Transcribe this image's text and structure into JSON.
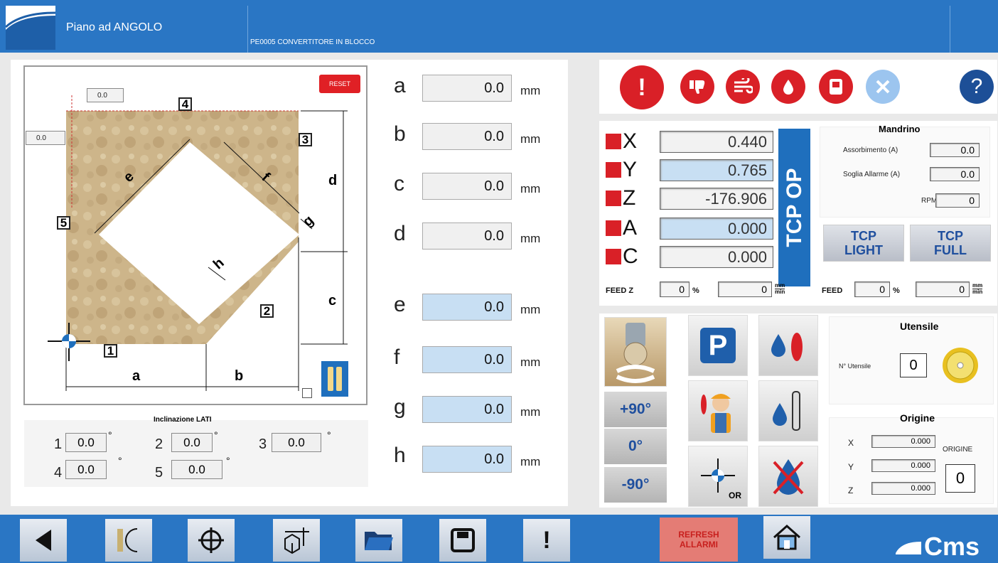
{
  "header": {
    "app_title": "Piano ad ANGOLO",
    "program_name": "PE0005 CONVERTITORE IN BLOCCO"
  },
  "drawing": {
    "reset_label": "RESET",
    "offset_top": "0.0",
    "offset_left": "0.0",
    "labels": {
      "a": "a",
      "b": "b",
      "c": "c",
      "d": "d",
      "e": "e",
      "f": "f",
      "g": "g",
      "h": "h",
      "n1": "1",
      "n2": "2",
      "n3": "3",
      "n4": "4",
      "n5": "5"
    }
  },
  "inclinazione": {
    "title": "Inclinazione LATI",
    "degree_symbol": "°",
    "items": [
      {
        "label": "1",
        "value": "0.0"
      },
      {
        "label": "2",
        "value": "0.0"
      },
      {
        "label": "3",
        "value": "0.0"
      },
      {
        "label": "4",
        "value": "0.0"
      },
      {
        "label": "5",
        "value": "0.0"
      }
    ]
  },
  "dimensions": {
    "unit": "mm",
    "fields": [
      {
        "label": "a",
        "value": "0.0"
      },
      {
        "label": "b",
        "value": "0.0"
      },
      {
        "label": "c",
        "value": "0.0"
      },
      {
        "label": "d",
        "value": "0.0"
      },
      {
        "label": "e",
        "value": "0.0"
      },
      {
        "label": "f",
        "value": "0.0"
      },
      {
        "label": "g",
        "value": "0.0"
      },
      {
        "label": "h",
        "value": "0.0"
      }
    ]
  },
  "alarm_icons": {
    "alert_icon": "exclamation-icon",
    "thumbs_down_icon": "thumbs-down-icon",
    "air_icon": "air-flow-icon",
    "water_icon": "water-drop-icon",
    "door_icon": "door-icon",
    "tools_icon": "tools-icon",
    "help_label": "?"
  },
  "axes": {
    "items": [
      {
        "label": "X",
        "value": "0.440"
      },
      {
        "label": "Y",
        "value": "0.765"
      },
      {
        "label": "Z",
        "value": "-176.906"
      },
      {
        "label": "A",
        "value": "0.000"
      },
      {
        "label": "C",
        "value": "0.000"
      }
    ],
    "tcp_op_label": "TCP OP",
    "tcp_light": [
      "TCP",
      "LIGHT"
    ],
    "tcp_full": [
      "TCP",
      "FULL"
    ]
  },
  "mandrino": {
    "title": "Mandrino",
    "assorbimento_label": "Assorbimento (A)",
    "assorbimento_value": "0.0",
    "soglia_label": "Soglia Allarme (A)",
    "soglia_value": "0.0",
    "rpm_label": "RPM",
    "rpm_value": "0"
  },
  "feed": {
    "feedz_label": "FEED Z",
    "feedz_pct": "0",
    "feedz_val": "0",
    "feed_label": "FEED",
    "feed_pct": "0",
    "feed_val": "0",
    "pct_symbol": "%",
    "unit_top": "mm",
    "unit_bottom": "min"
  },
  "rotation": {
    "plus90": "+90°",
    "zero": "0°",
    "minus90": "-90°",
    "origin_tile_label": "OR",
    "parking_label": "P"
  },
  "utensile": {
    "title": "Utensile",
    "label": "N° Utensile",
    "value": "0"
  },
  "origine": {
    "title": "Origine",
    "x_label": "X",
    "x_value": "0.000",
    "y_label": "Y",
    "y_value": "0.000",
    "z_label": "Z",
    "z_value": "0.000",
    "origine_label": "ORIGINE",
    "origine_value": "0"
  },
  "footer": {
    "refresh_line1": "REFRESH",
    "refresh_line2": "ALLARMI",
    "brand": "Cms",
    "alert_label": "!"
  },
  "colors": {
    "header_blue": "#2a76c4",
    "alarm_red": "#d92027",
    "field_blue": "#c8dff3"
  }
}
